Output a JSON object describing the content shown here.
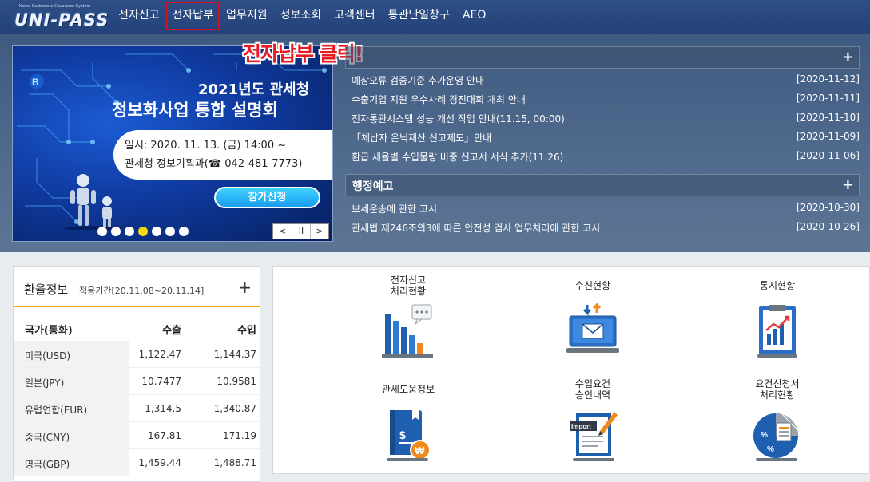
{
  "header": {
    "logo_sub": "Korea Customs e-Clearance System",
    "logo_main": "UNI-PASS",
    "nav": [
      "전자신고",
      "전자납부",
      "업무지원",
      "정보조회",
      "고객센터",
      "통관단일창구",
      "AEO"
    ]
  },
  "callout": "전자납부 클릭!",
  "banner": {
    "title1": "2021년도 관세청",
    "title2": "정보화사업 통합 설명회",
    "date": "일시: 2020. 11. 13. (금) 14:00 ~",
    "place": "관세청 정보기획과(☎ 042-481-7773)",
    "apply": "참가신청",
    "dot_count": 7,
    "active_dot": 3,
    "controls": [
      "<",
      "II",
      ">"
    ]
  },
  "notices": {
    "plus": "+",
    "items": [
      {
        "title": "예상오류 검증기준 추가운영 안내",
        "date": "[2020-11-12]"
      },
      {
        "title": "수출기업 지원 우수사례 경진대회 개최 안내",
        "date": "[2020-11-11]"
      },
      {
        "title": "전자통관시스템 성능 개선 작업 안내(11.15, 00:00)",
        "date": "[2020-11-10]"
      },
      {
        "title": "「체납자 은닉재산 신고제도」안내",
        "date": "[2020-11-09]"
      },
      {
        "title": "환급 세율별 수입물량 비중 신고서 서식 추가(11.26)",
        "date": "[2020-11-06]"
      }
    ]
  },
  "admin": {
    "title": "행정예고",
    "plus": "+",
    "items": [
      {
        "title": "보세운송에 관한 고시",
        "date": "[2020-10-30]"
      },
      {
        "title": "관세법 제246조의3에 따른 안전성 검사 업무처리에 관한 고시",
        "date": "[2020-10-26]"
      }
    ]
  },
  "exchange": {
    "title": "환율정보",
    "period": "적용기간[20.11.08~20.11.14]",
    "plus": "+",
    "headers": [
      "국가(통화)",
      "수출",
      "수입"
    ],
    "rows": [
      [
        "미국(USD)",
        "1,122.47",
        "1,144.37"
      ],
      [
        "일본(JPY)",
        "10.7477",
        "10.9581"
      ],
      [
        "유럽연합(EUR)",
        "1,314.5",
        "1,340.87"
      ],
      [
        "중국(CNY)",
        "167.81",
        "171.19"
      ],
      [
        "영국(GBP)",
        "1,459.44",
        "1,488.71"
      ]
    ]
  },
  "services": [
    {
      "label1": "전자신고",
      "label2": "처리현황",
      "icon": "bar-chart-icon"
    },
    {
      "label1": "수신현황",
      "label2": "",
      "icon": "inbox-monitor-icon"
    },
    {
      "label1": "통지현황",
      "label2": "",
      "icon": "report-icon"
    },
    {
      "label1": "관세도움정보",
      "label2": "",
      "icon": "tax-book-icon"
    },
    {
      "label1": "수입요건",
      "label2": "승인내역",
      "icon": "import-document-icon"
    },
    {
      "label1": "요건신청서",
      "label2": "처리현황",
      "icon": "percent-chart-icon"
    }
  ],
  "colors": {
    "header": "#2f4f86",
    "accent": "#f2a200",
    "callout": "#e61b24",
    "highlight_box": "#d4101c"
  }
}
